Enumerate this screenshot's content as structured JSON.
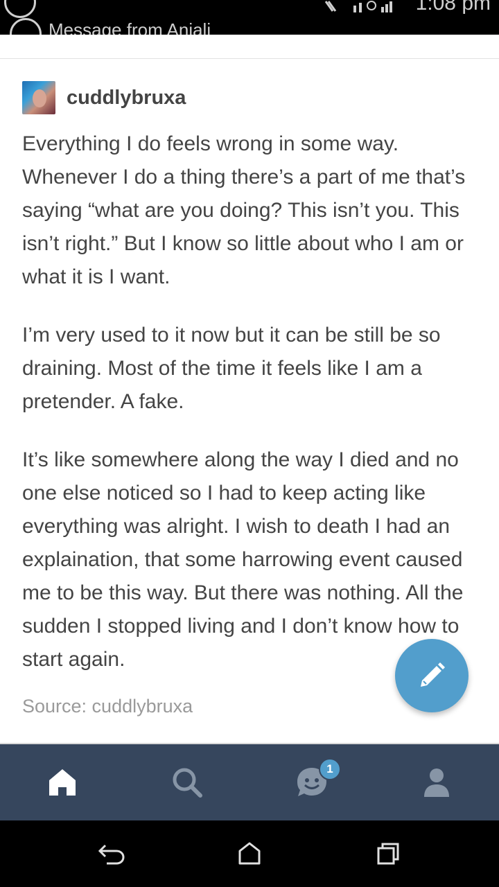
{
  "status_bar": {
    "notification_text": "Message from Anjali",
    "time": "1:08 pm"
  },
  "post": {
    "username": "cuddlybruxa",
    "paragraphs": [
      "Everything I do feels wrong in some way. Whenever I do a thing there’s a part of me that’s saying “what are you doing? This isn’t you. This isn’t right.” But I know so little about who I am or what it is I want.",
      "I’m very used to it now but it can be still be so draining. Most of the time it feels like I am a pretender. A fake.",
      "It’s like somewhere along the way I died and no one else noticed so I had to keep acting like everything was alright. I wish to death I had an explaination, that some harrowing event caused me to be this way. But there was nothing. All the sudden I stopped living and I don’t know how to start again."
    ],
    "source": "Source: cuddlybruxa"
  },
  "bottom_nav": {
    "items": [
      {
        "icon": "home-icon",
        "active": true
      },
      {
        "icon": "search-icon",
        "active": false
      },
      {
        "icon": "activity-icon",
        "active": false
      },
      {
        "icon": "account-icon",
        "active": false
      }
    ],
    "activity_badge": "1"
  },
  "colors": {
    "nav_background": "#36465d",
    "accent": "#529ecc",
    "text": "#444444"
  },
  "system_nav": {
    "icons": [
      "back-icon",
      "home-button-icon",
      "recents-icon"
    ]
  }
}
